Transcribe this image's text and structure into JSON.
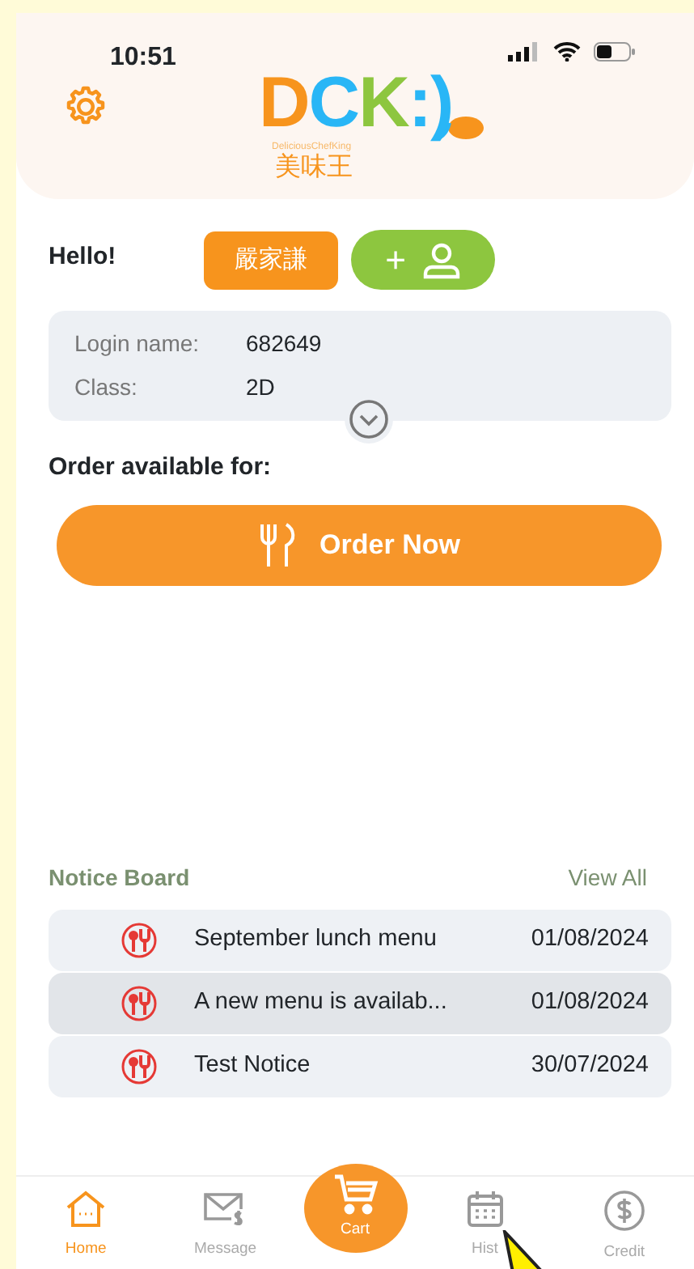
{
  "status_bar": {
    "time": "10:51"
  },
  "logo": {
    "letters": [
      {
        "text": "D",
        "color": "#f7941d"
      },
      {
        "text": "C",
        "color": "#29b6f6"
      },
      {
        "text": "K",
        "color": "#8dc63f"
      },
      {
        "text": ":)",
        "color": "#29b6f6"
      }
    ],
    "tagline": "DeliciousChefKing",
    "chinese": "美味王"
  },
  "greeting": "Hello!",
  "student_button": "嚴家謙",
  "add_button": "+",
  "info": [
    {
      "label": "Login name:",
      "value": "682649"
    },
    {
      "label": "Class:",
      "value": "2D"
    }
  ],
  "order_heading": "Order available for:",
  "order_button": "Order Now",
  "notice_board": {
    "title": "Notice Board",
    "view_all": "View All",
    "items": [
      {
        "title": "September lunch menu",
        "date": "01/08/2024",
        "selected": false
      },
      {
        "title": "A new menu is availab...",
        "date": "01/08/2024",
        "selected": true
      },
      {
        "title": "Test Notice",
        "date": "30/07/2024",
        "selected": false
      }
    ]
  },
  "tab_bar": [
    {
      "kind": "home",
      "label": "Home",
      "selected": true
    },
    {
      "kind": "message",
      "label": "Message",
      "selected": false
    },
    {
      "kind": "cart",
      "label": "Cart",
      "selected": false
    },
    {
      "kind": "history",
      "label": "Hist",
      "selected": false
    },
    {
      "kind": "credit",
      "label": "Credit",
      "selected": false
    }
  ]
}
